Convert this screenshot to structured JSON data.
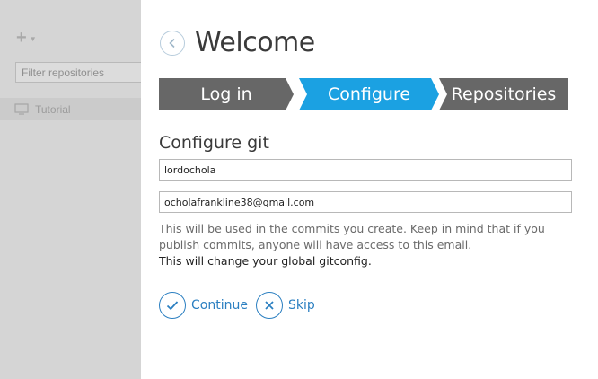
{
  "sidebar": {
    "add_icon": "plus-icon",
    "filter": {
      "placeholder": "Filter repositories",
      "value": ""
    },
    "repositories": [
      {
        "label": "Tutorial",
        "icon": "monitor-icon"
      }
    ]
  },
  "main": {
    "back_icon": "chevron-left-icon",
    "title": "Welcome",
    "steps": [
      {
        "label": "Log in",
        "state": "inactive"
      },
      {
        "label": "Configure",
        "state": "active"
      },
      {
        "label": "Repositories",
        "state": "inactive"
      }
    ],
    "section_title": "Configure git",
    "name_value": "lordochola",
    "email_value": "ocholafrankline38@gmail.com",
    "help_line1": "This will be used in the commits you create. Keep in mind that if you publish commits, anyone will have access to this email.",
    "help_line2": "This will change your global gitconfig.",
    "continue_label": "Continue",
    "skip_label": "Skip"
  },
  "colors": {
    "accent": "#1ba1e2",
    "step_inactive": "#676767",
    "link": "#2b7fc1",
    "sidebar_bg": "#d5d5d5"
  }
}
